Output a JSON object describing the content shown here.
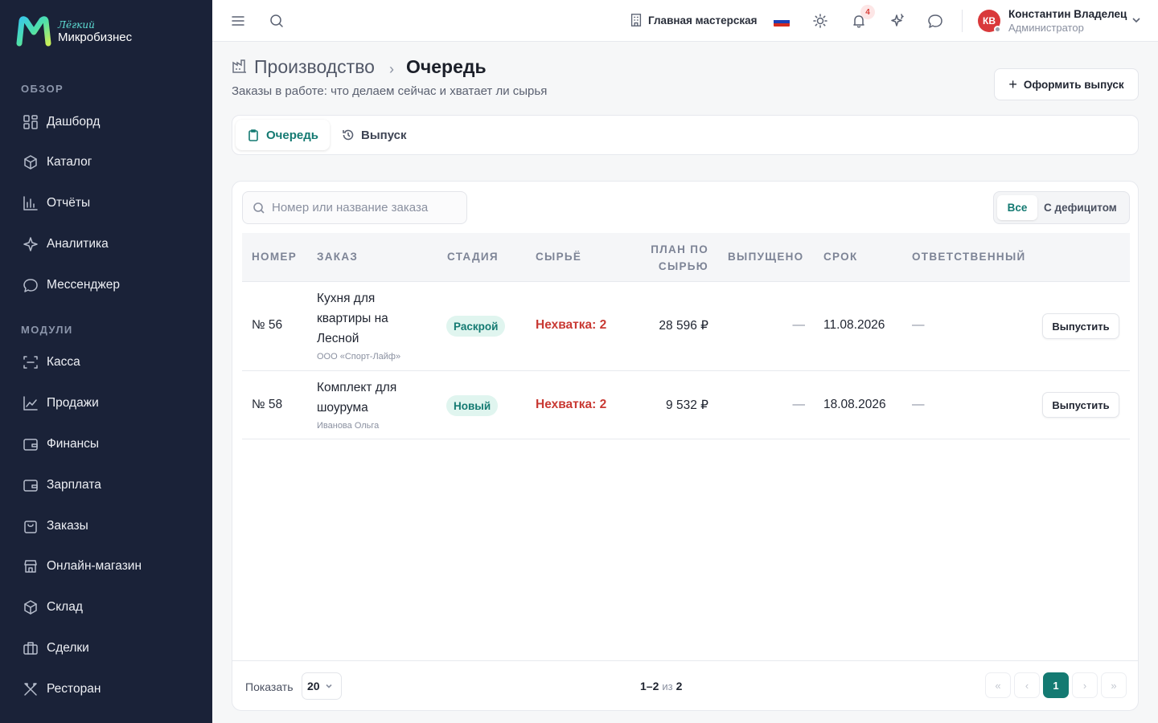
{
  "brand": {
    "small": "Лёгкий",
    "name": "Микробизнес"
  },
  "sidebar": {
    "sections": [
      {
        "title": "ОБЗОР",
        "items": [
          {
            "label": "Дашборд",
            "icon": "grid-icon"
          },
          {
            "label": "Каталог",
            "icon": "box-tag-icon"
          },
          {
            "label": "Отчёты",
            "icon": "bar-chart-icon"
          },
          {
            "label": "Аналитика",
            "icon": "sparkle-icon"
          },
          {
            "label": "Мессенджер",
            "icon": "chat-icon"
          }
        ]
      },
      {
        "title": "МОДУЛИ",
        "items": [
          {
            "label": "Касса",
            "icon": "scan-icon"
          },
          {
            "label": "Продажи",
            "icon": "trend-icon"
          },
          {
            "label": "Финансы",
            "icon": "wallet-icon"
          },
          {
            "label": "Зарплата",
            "icon": "wallet-icon"
          },
          {
            "label": "Заказы",
            "icon": "bag-icon"
          },
          {
            "label": "Онлайн-магазин",
            "icon": "store-icon"
          },
          {
            "label": "Склад",
            "icon": "cube-icon"
          },
          {
            "label": "Сделки",
            "icon": "briefcase-icon"
          },
          {
            "label": "Ресторан",
            "icon": "utensils-icon"
          }
        ]
      }
    ]
  },
  "header": {
    "workshop": "Главная мастерская",
    "notifications_count": "4",
    "user": {
      "initials": "КВ",
      "name": "Константин Владелец",
      "role": "Администратор"
    },
    "flag_colors": [
      "#ffffff",
      "#1c3fb5",
      "#d52b1e"
    ]
  },
  "page": {
    "breadcrumb_parent": "Производство",
    "breadcrumb_sep": "›",
    "title": "Очередь",
    "subtitle": "Заказы в работе: что делаем сейчас и хватает ли сырья",
    "primary_action": "Оформить выпуск"
  },
  "tabs": [
    {
      "label": "Очередь",
      "active": true
    },
    {
      "label": "Выпуск",
      "active": false
    }
  ],
  "search": {
    "placeholder": "Номер или название заказа"
  },
  "filters": {
    "all": "Все",
    "deficit": "С дефицитом",
    "selected": "all"
  },
  "table": {
    "columns": {
      "number": "Номер",
      "order": "Заказ",
      "stage": "Стадия",
      "material": "Сырьё",
      "plan": "План по сырью",
      "released": "Выпущено",
      "deadline": "Срок",
      "responsible": "Ответственный"
    },
    "rows": [
      {
        "number": "№ 56",
        "name": "Кухня для квартиры на Лесной",
        "customer": "ООО «Спорт-Лайф»",
        "stage": "Раскрой",
        "material": "Нехватка: 2",
        "plan": "28 596 ₽",
        "released": "—",
        "deadline": "11.08.2026",
        "responsible": "—",
        "action": "Выпустить"
      },
      {
        "number": "№ 58",
        "name": "Комплект для шоурума",
        "customer": "Иванова Ольга",
        "stage": "Новый",
        "material": "Нехватка: 2",
        "plan": "9 532 ₽",
        "released": "—",
        "deadline": "18.08.2026",
        "responsible": "—",
        "action": "Выпустить"
      }
    ]
  },
  "pagination": {
    "show_label": "Показать",
    "page_size": "20",
    "range": "1–2",
    "of": "из",
    "total": "2",
    "current_page": "1",
    "first": "«",
    "prev": "‹",
    "next": "›",
    "last": "»"
  },
  "colors": {
    "accent": "#147a72",
    "sidebar_bg": "#1a2238",
    "shortage": "#c93a34",
    "stage_bg": "#e0f5ef"
  }
}
